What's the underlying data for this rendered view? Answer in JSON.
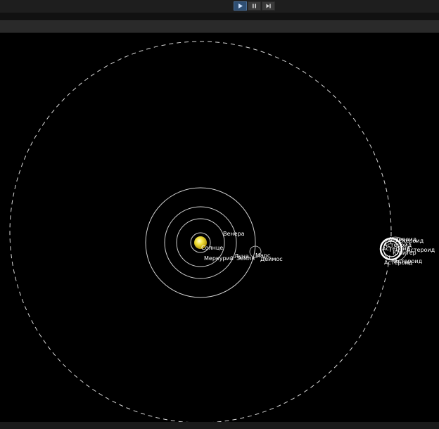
{
  "toolbar": {
    "play_icon": "play-icon",
    "pause_icon": "pause-icon",
    "step_icon": "step-forward-icon",
    "accent": "#2f4f73"
  },
  "scene": {
    "sun_color": "#f2e23a",
    "labels": {
      "sun": "Солнце",
      "mercury": "Меркурий",
      "venus": "Венера",
      "earth": "Земля",
      "moon": "Луна",
      "mars": "Марс",
      "deimos": "Деймос",
      "jupiter": "Юпитер",
      "asteroid": "Астероид"
    }
  }
}
